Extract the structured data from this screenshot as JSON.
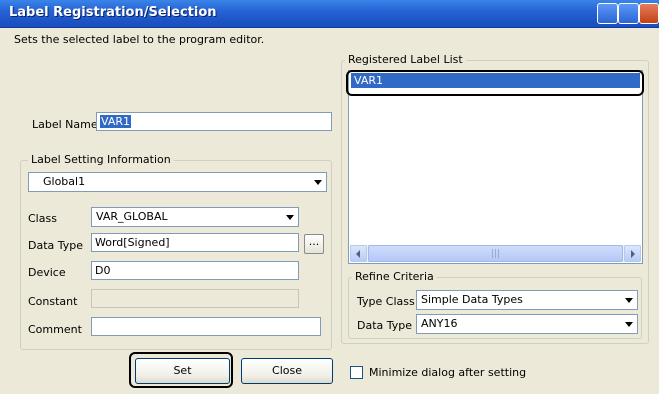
{
  "window": {
    "title": "Label Registration/Selection"
  },
  "description": "Sets the selected label to the program editor.",
  "label_name": {
    "label": "Label Name",
    "value": "VAR1"
  },
  "label_setting": {
    "group_title": "Label Setting Information",
    "scope": "Global1",
    "class_label": "Class",
    "class_value": "VAR_GLOBAL",
    "data_type_label": "Data Type",
    "data_type_value": "Word[Signed]",
    "browse_label": "...",
    "device_label": "Device",
    "device_value": "D0",
    "constant_label": "Constant",
    "constant_value": "",
    "comment_label": "Comment",
    "comment_value": ""
  },
  "registered_list": {
    "group_title": "Registered Label List",
    "items": [
      "VAR1"
    ],
    "scroll_thumb_glyph": "|||"
  },
  "refine": {
    "group_title": "Refine Criteria",
    "type_class_label": "Type Class",
    "type_class_value": "Simple Data Types",
    "data_type_label": "Data Type",
    "data_type_value": "ANY16"
  },
  "buttons": {
    "set": "Set",
    "close": "Close"
  },
  "minimize": {
    "label": "Minimize dialog after setting",
    "checked": false
  }
}
